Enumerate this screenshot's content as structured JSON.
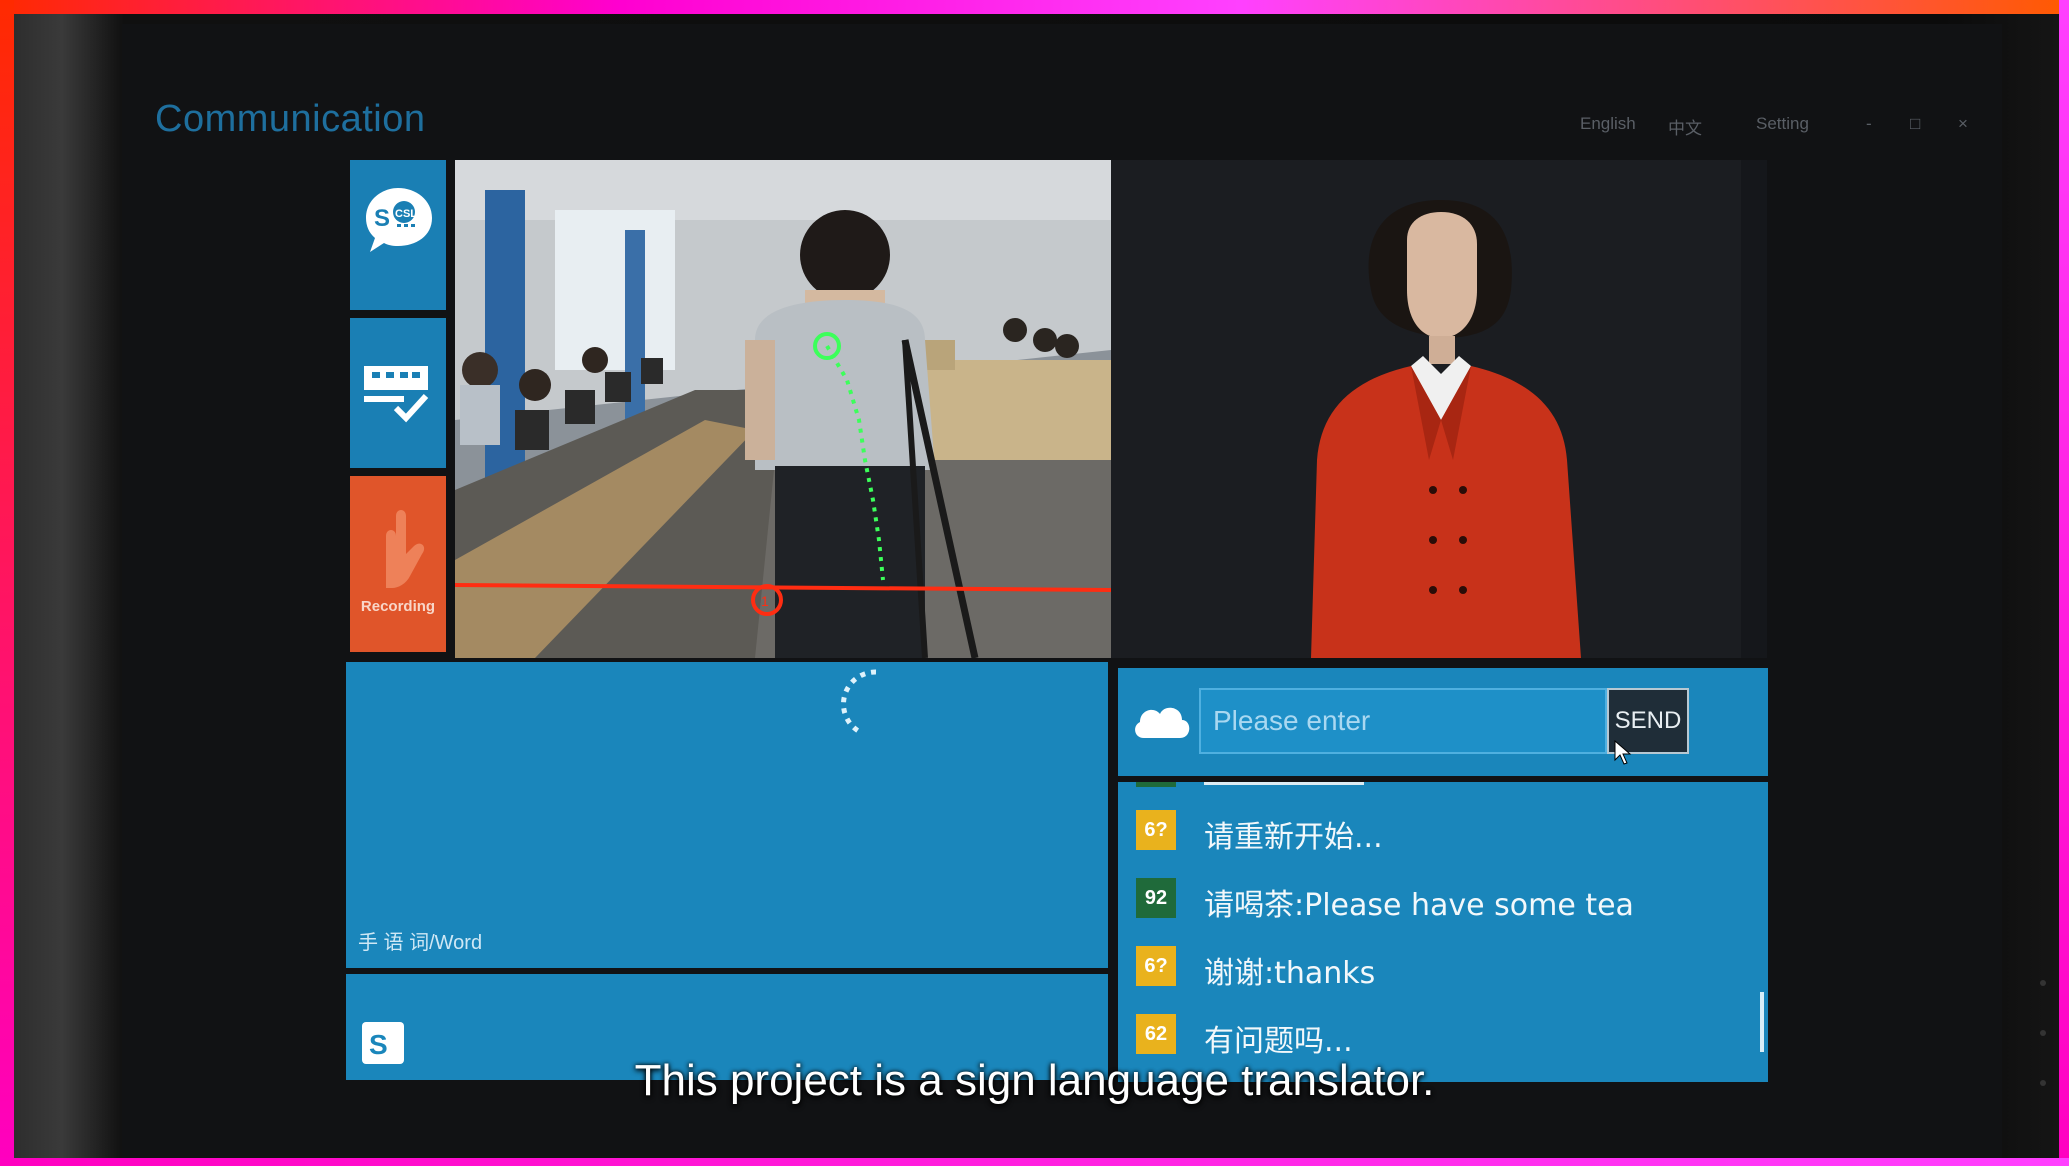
{
  "app": {
    "title": "Communication"
  },
  "top_menu": {
    "english": "English",
    "chinese": "中文",
    "setting": "Setting",
    "minimize": "-",
    "maximize": "□",
    "close": "×"
  },
  "tiles": {
    "chat_icon": "chat-bubble-icon",
    "keyboard_icon": "keyboard-check-icon",
    "record_icon": "hand-icon",
    "record_label": "Recording"
  },
  "word_panel": {
    "label": "手 语 词/Word"
  },
  "input": {
    "placeholder": "Please enter",
    "send_label": "SEND"
  },
  "history": [
    {
      "score": "6?",
      "badge_color": "#e9b21d",
      "text": "请重新开始..."
    },
    {
      "score": "92",
      "badge_color": "#1f6a3a",
      "text": "请喝茶:Please have some tea"
    },
    {
      "score": "6?",
      "badge_color": "#e9b21d",
      "text": "谢谢:thanks"
    },
    {
      "score": "62",
      "badge_color": "#e9b21d",
      "text": "有问题吗..."
    }
  ],
  "subtitle": "This project is a sign language translator.",
  "colors": {
    "tile_blue": "#1a7fb4",
    "panel_blue": "#1a86bb",
    "record_orange": "#e0552a",
    "title_blue": "#1e6f9e"
  }
}
